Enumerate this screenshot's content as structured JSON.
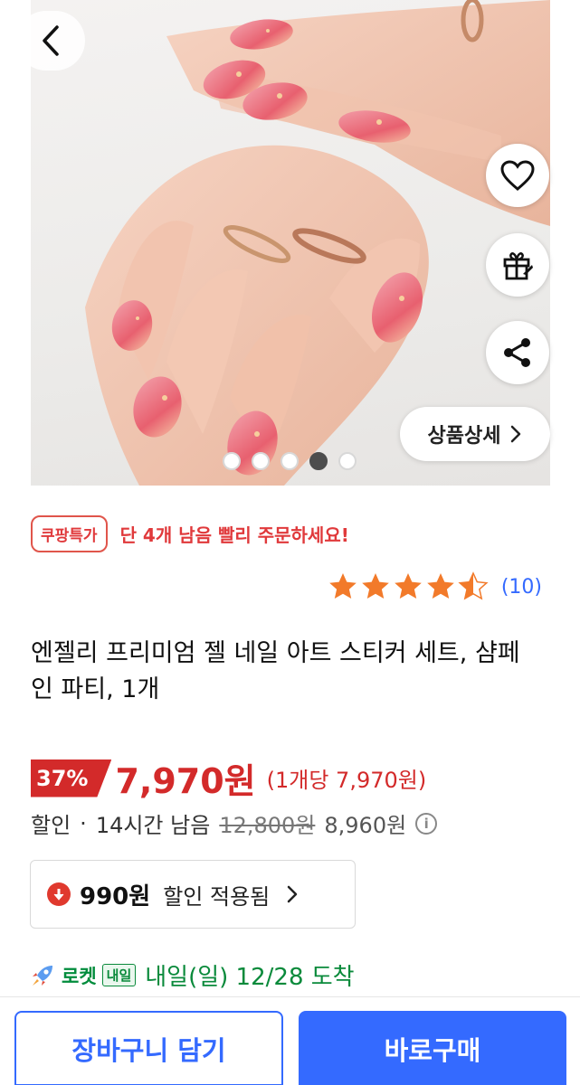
{
  "hero": {
    "image_alt": "",
    "detail_label": "상품상세",
    "dot_count": 5,
    "active_dot": 3
  },
  "deal": {
    "badge": "쿠팡특가",
    "message": "단 4개 남음 빨리 주문하세요!"
  },
  "rating": {
    "stars": 4.5,
    "count_text": "(10)"
  },
  "product": {
    "title": "엔젤리 프리미엄 젤 네일 아트 스티커 세트, 샴페인 파티, 1개"
  },
  "price": {
    "discount_rate": "37%",
    "sale_price": "7,970원",
    "unit_price": "(1개당 7,970원)",
    "discount_label": "할인",
    "time_left": "14시간 남음",
    "separator": "·",
    "original_price": "12,800원",
    "member_price": "8,960원"
  },
  "coupon": {
    "amount": "990원",
    "text": "할인 적용됨"
  },
  "delivery": {
    "rocket_label": "로켓",
    "tomorrow_badge": "내일",
    "arrival_text": "내일(일) 12/28 도착"
  },
  "actions": {
    "cart_label": "장바구니 담기",
    "buy_label": "바로구매"
  },
  "colors": {
    "accent_blue": "#346aff",
    "sale_red": "#d32a2a",
    "rocket_green": "#0a8a3b",
    "star_orange": "#f27a2a"
  }
}
